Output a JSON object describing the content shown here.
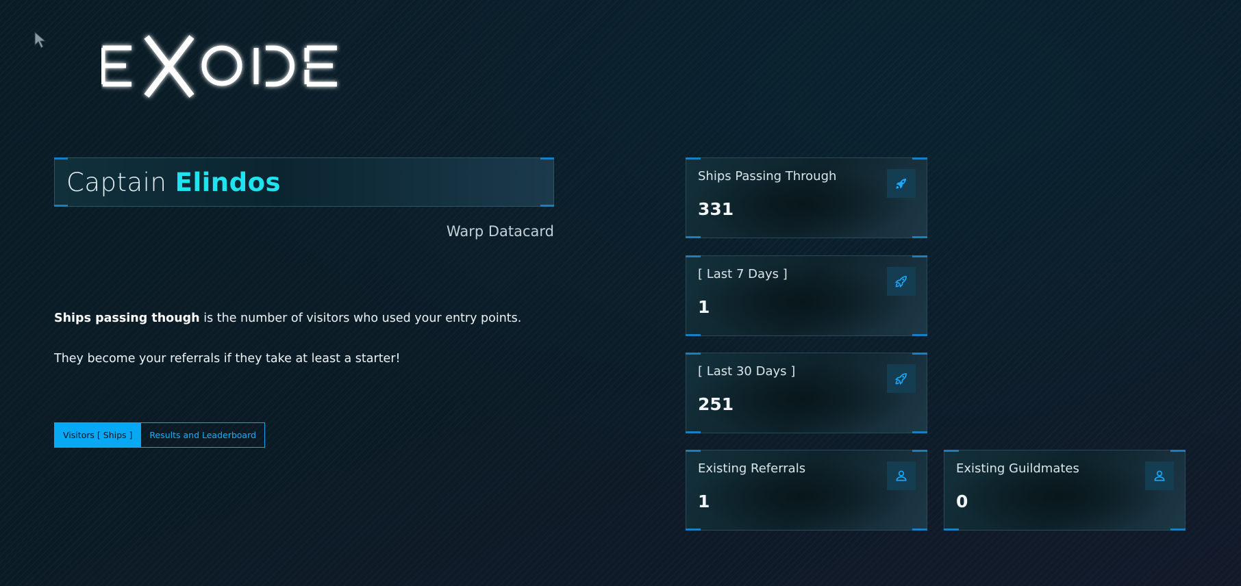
{
  "brand": {
    "logo_text": "EXODE"
  },
  "captain": {
    "prefix": "Captain",
    "name": "Elindos"
  },
  "warp_label": "Warp Datacard",
  "description": {
    "line1_bold": "Ships passing though",
    "line1_rest": " is the number of visitors who used your entry points.",
    "line2": "They become your referrals if they take at least a starter!"
  },
  "tabs": [
    {
      "label": "Visitors [ Ships ]",
      "active": true
    },
    {
      "label": "Results and Leaderboard",
      "active": false
    }
  ],
  "stats": {
    "ships_passing": {
      "label": "Ships Passing Through",
      "value": "331",
      "icon": "rocket-icon"
    },
    "last_7_days": {
      "label": "[ Last 7 Days ]",
      "value": "1",
      "icon": "rocket-icon"
    },
    "last_30_days": {
      "label": "[ Last 30 Days ]",
      "value": "251",
      "icon": "rocket-icon"
    },
    "existing_referrals": {
      "label": "Existing Referrals",
      "value": "1",
      "icon": "user-icon"
    },
    "existing_guildmates": {
      "label": "Existing Guildmates",
      "value": "0",
      "icon": "user-icon"
    }
  },
  "colors": {
    "accent_cyan": "#1fe3ee",
    "accent_blue": "#08a8f4",
    "icon_blue": "#1aa9ff",
    "background": "#0a1d27"
  }
}
